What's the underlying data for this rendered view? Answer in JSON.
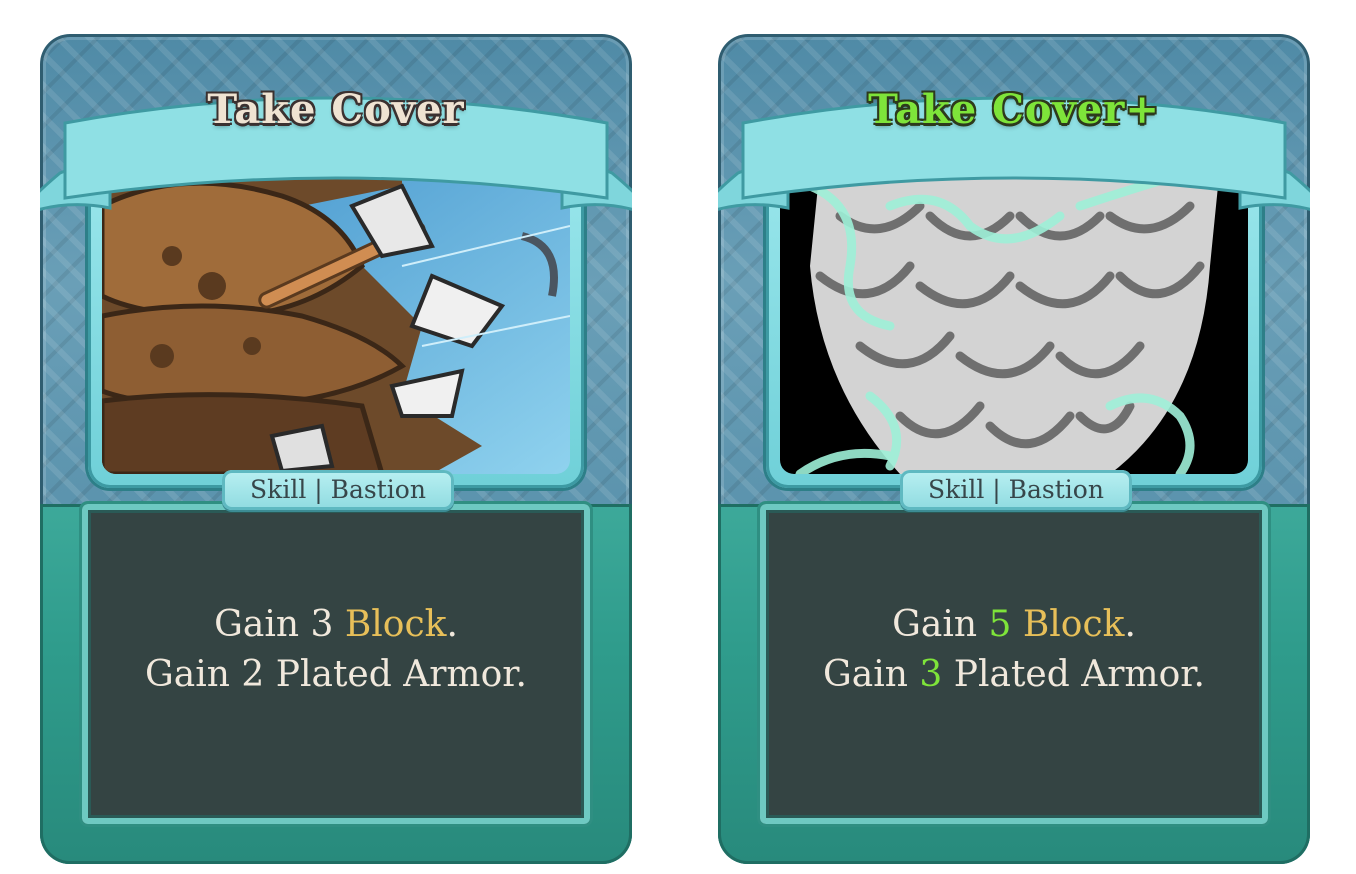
{
  "cards": [
    {
      "title": "Take Cover",
      "type_line": "Skill | Bastion",
      "desc_line1": {
        "prefix": "Gain",
        "value": "3",
        "keyword": "Block",
        "suffix": "."
      },
      "desc_line2": {
        "prefix": "Gain",
        "value": "2",
        "rest": "Plated Armor."
      },
      "upgraded": false,
      "art_icon": "arrow-in-barricade-art"
    },
    {
      "title": "Take Cover+",
      "type_line": "Skill | Bastion",
      "desc_line1": {
        "prefix": "Gain",
        "value": "5",
        "keyword": "Block",
        "suffix": "."
      },
      "desc_line2": {
        "prefix": "Gain",
        "value": "3",
        "rest": "Plated Armor."
      },
      "upgraded": true,
      "art_icon": "scaled-shield-art"
    }
  ],
  "colors": {
    "keyword": "#e7bf59",
    "upgrade": "#7ee43a",
    "text": "#f0e8dc",
    "panel": "#344443",
    "frame_top": "#5b93ad",
    "frame_bottom": "#2f9c8c"
  }
}
